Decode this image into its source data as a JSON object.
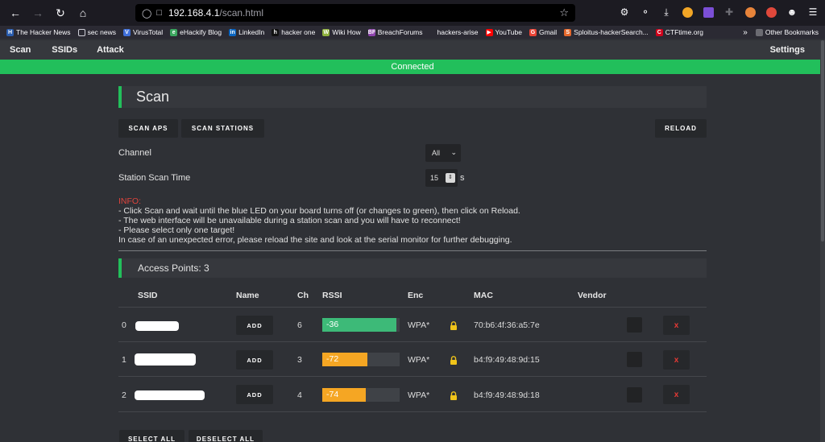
{
  "browser": {
    "url_host": "192.168.4.1",
    "url_path": "/scan.html",
    "bookmarks": [
      {
        "label": "The Hacker News",
        "icon": "H",
        "color": "#2a5db0"
      },
      {
        "label": "sec news",
        "icon": "folder",
        "color": "#6b6b72"
      },
      {
        "label": "VirusTotal",
        "icon": "V",
        "color": "#3f6fd9"
      },
      {
        "label": "eHackify Blog",
        "icon": "e",
        "color": "#3aa55e"
      },
      {
        "label": "LinkedIn",
        "icon": "in",
        "color": "#0a66c2"
      },
      {
        "label": "hacker one",
        "icon": "h",
        "color": "#111111"
      },
      {
        "label": "Wiki How",
        "icon": "W",
        "color": "#8fb13d"
      },
      {
        "label": "BreachForums",
        "icon": "BF",
        "color": "#8e44ad"
      },
      {
        "label": "hackers-arise",
        "icon": "",
        "color": "#2b2a33"
      },
      {
        "label": "YouTube",
        "icon": "▶",
        "color": "#ff0000"
      },
      {
        "label": "Gmail",
        "icon": "G",
        "color": "#ea4335"
      },
      {
        "label": "Sploitus-hackerSearch...",
        "icon": "S",
        "color": "#e5682c"
      },
      {
        "label": "CTFtime.org",
        "icon": "C",
        "color": "#d0021b"
      }
    ],
    "other_bookmarks": "Other Bookmarks"
  },
  "nav": {
    "scan": "Scan",
    "ssids": "SSIDs",
    "attack": "Attack",
    "settings": "Settings"
  },
  "status": "Connected",
  "scan": {
    "title": "Scan",
    "scan_aps": "SCAN APS",
    "scan_stations": "SCAN STATIONS",
    "reload": "RELOAD",
    "channel_label": "Channel",
    "channel_value": "All",
    "station_time_label": "Station Scan Time",
    "station_time_value": "15",
    "station_time_unit": "s",
    "info_head": "INFO:",
    "info_lines": [
      "- Click Scan and wait until the blue LED on your board turns off (or changes to green), then click on Reload.",
      "- The web interface will be unavailable during a station scan and you will have to reconnect!",
      "- Please select only one target!",
      "In case of an unexpected error, please reload the site and look at the serial monitor for further debugging."
    ]
  },
  "access_points": {
    "title": "Access Points: 3",
    "headers": {
      "ssid": "SSID",
      "name": "Name",
      "ch": "Ch",
      "rssi": "RSSI",
      "enc": "Enc",
      "mac": "MAC",
      "vendor": "Vendor"
    },
    "add_label": "ADD",
    "remove_label": "x",
    "rows": [
      {
        "index": "0",
        "ch": "6",
        "rssi": "-36",
        "rssi_fill": 0.96,
        "rssi_color": "#3dba78",
        "enc": "WPA*",
        "mac": "70:b6:4f:36:a5:7e"
      },
      {
        "index": "1",
        "ch": "3",
        "rssi": "-72",
        "rssi_fill": 0.58,
        "rssi_color": "#f5a623",
        "enc": "WPA*",
        "mac": "b4:f9:49:48:9d:15"
      },
      {
        "index": "2",
        "ch": "4",
        "rssi": "-74",
        "rssi_fill": 0.56,
        "rssi_color": "#f5a623",
        "enc": "WPA*",
        "mac": "b4:f9:49:48:9d:18"
      }
    ],
    "select_all": "SELECT ALL",
    "deselect_all": "DESELECT ALL"
  },
  "colors": {
    "accent": "#22bf5b",
    "danger": "#e53935",
    "lock": "#f0c419"
  }
}
